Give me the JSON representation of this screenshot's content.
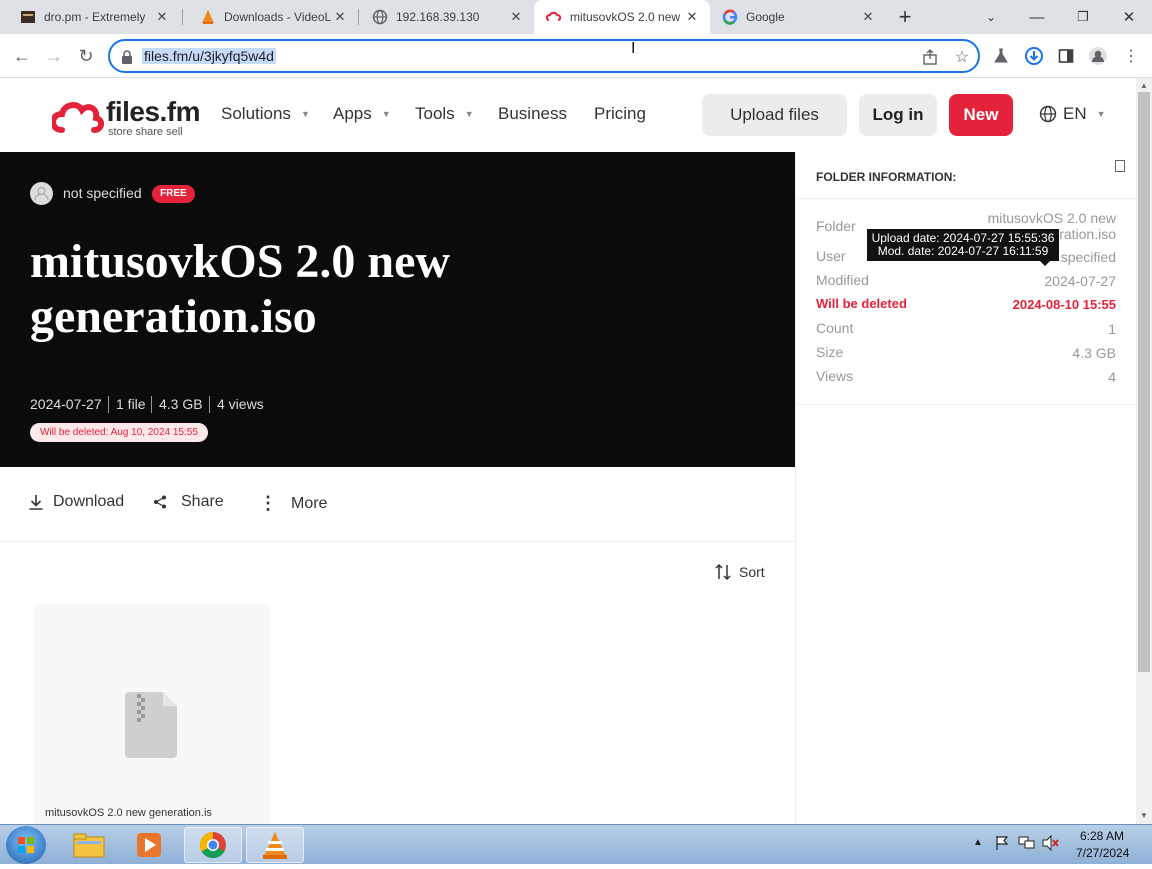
{
  "browser": {
    "tabs": [
      {
        "title": "dro.pm - Extremely",
        "icon": "dropm-icon"
      },
      {
        "title": "Downloads - VideoL",
        "icon": "vlc-icon"
      },
      {
        "title": "192.168.39.130",
        "icon": "globe-icon"
      },
      {
        "title": "mitusovkOS 2.0 new",
        "icon": "filesfm-icon"
      },
      {
        "title": "Google",
        "icon": "google-icon"
      }
    ],
    "url": "files.fm/u/3jkyfq5w4d"
  },
  "header": {
    "logo_text": "files.fm",
    "logo_tagline": "store share sell",
    "nav": [
      "Solutions",
      "Apps",
      "Tools",
      "Business",
      "Pricing"
    ],
    "upload_label": "Upload files",
    "login_label": "Log in",
    "new_label": "New",
    "lang_label": "EN"
  },
  "hero": {
    "user": "not specified",
    "badge": "FREE",
    "title": "mitusovkOS 2.0 new generation.iso",
    "date": "2024-07-27",
    "files": "1 file",
    "size": "4.3 GB",
    "views": "4 views",
    "delete_notice": "Will be deleted: Aug 10, 2024 15:55"
  },
  "actions": {
    "download": "Download",
    "share": "Share",
    "more": "More",
    "sort": "Sort"
  },
  "file_card": {
    "name": "mitusovkOS 2.0 new generation.is"
  },
  "folder_info": {
    "heading": "FOLDER INFORMATION:",
    "folder_label": "Folder",
    "folder_value_line1": "mitusovkOS 2.0 new",
    "folder_value_line2": "generation.iso",
    "user_label": "User",
    "user_value": "specified",
    "modified_label": "Modified",
    "modified_value": "2024-07-27",
    "deleted_label": "Will be deleted",
    "deleted_value": "2024-08-10 15:55",
    "count_label": "Count",
    "count_value": "1",
    "size_label": "Size",
    "size_value": "4.3 GB",
    "views_label": "Views",
    "views_value": "4"
  },
  "tooltip": {
    "line1": "Upload date: 2024-07-27 15:55:36",
    "line2": "Mod. date: 2024-07-27 16:11:59"
  },
  "taskbar": {
    "time": "6:28 AM",
    "date": "7/27/2024"
  },
  "colors": {
    "brand_red": "#e4233b",
    "hero_bg": "#0b0b0b",
    "accent_blue": "#1a73e8"
  }
}
